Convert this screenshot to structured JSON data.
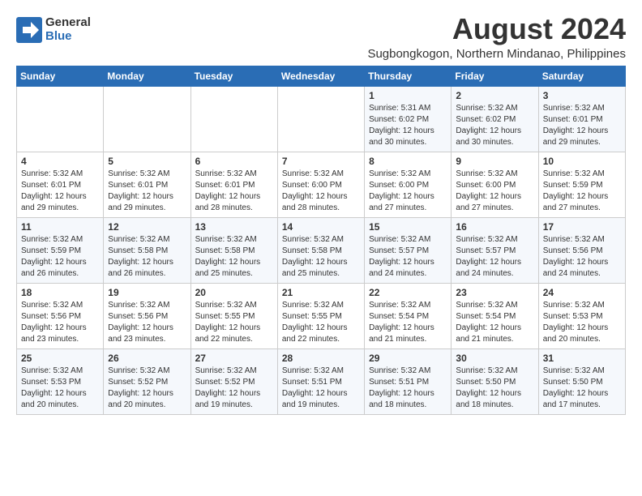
{
  "logo": {
    "general": "General",
    "blue": "Blue"
  },
  "title": {
    "month_year": "August 2024",
    "location": "Sugbongkogon, Northern Mindanao, Philippines"
  },
  "weekdays": [
    "Sunday",
    "Monday",
    "Tuesday",
    "Wednesday",
    "Thursday",
    "Friday",
    "Saturday"
  ],
  "weeks": [
    [
      {
        "day": "",
        "info": ""
      },
      {
        "day": "",
        "info": ""
      },
      {
        "day": "",
        "info": ""
      },
      {
        "day": "",
        "info": ""
      },
      {
        "day": "1",
        "info": "Sunrise: 5:31 AM\nSunset: 6:02 PM\nDaylight: 12 hours and 30 minutes."
      },
      {
        "day": "2",
        "info": "Sunrise: 5:32 AM\nSunset: 6:02 PM\nDaylight: 12 hours and 30 minutes."
      },
      {
        "day": "3",
        "info": "Sunrise: 5:32 AM\nSunset: 6:01 PM\nDaylight: 12 hours and 29 minutes."
      }
    ],
    [
      {
        "day": "4",
        "info": "Sunrise: 5:32 AM\nSunset: 6:01 PM\nDaylight: 12 hours and 29 minutes."
      },
      {
        "day": "5",
        "info": "Sunrise: 5:32 AM\nSunset: 6:01 PM\nDaylight: 12 hours and 29 minutes."
      },
      {
        "day": "6",
        "info": "Sunrise: 5:32 AM\nSunset: 6:01 PM\nDaylight: 12 hours and 28 minutes."
      },
      {
        "day": "7",
        "info": "Sunrise: 5:32 AM\nSunset: 6:00 PM\nDaylight: 12 hours and 28 minutes."
      },
      {
        "day": "8",
        "info": "Sunrise: 5:32 AM\nSunset: 6:00 PM\nDaylight: 12 hours and 27 minutes."
      },
      {
        "day": "9",
        "info": "Sunrise: 5:32 AM\nSunset: 6:00 PM\nDaylight: 12 hours and 27 minutes."
      },
      {
        "day": "10",
        "info": "Sunrise: 5:32 AM\nSunset: 5:59 PM\nDaylight: 12 hours and 27 minutes."
      }
    ],
    [
      {
        "day": "11",
        "info": "Sunrise: 5:32 AM\nSunset: 5:59 PM\nDaylight: 12 hours and 26 minutes."
      },
      {
        "day": "12",
        "info": "Sunrise: 5:32 AM\nSunset: 5:58 PM\nDaylight: 12 hours and 26 minutes."
      },
      {
        "day": "13",
        "info": "Sunrise: 5:32 AM\nSunset: 5:58 PM\nDaylight: 12 hours and 25 minutes."
      },
      {
        "day": "14",
        "info": "Sunrise: 5:32 AM\nSunset: 5:58 PM\nDaylight: 12 hours and 25 minutes."
      },
      {
        "day": "15",
        "info": "Sunrise: 5:32 AM\nSunset: 5:57 PM\nDaylight: 12 hours and 24 minutes."
      },
      {
        "day": "16",
        "info": "Sunrise: 5:32 AM\nSunset: 5:57 PM\nDaylight: 12 hours and 24 minutes."
      },
      {
        "day": "17",
        "info": "Sunrise: 5:32 AM\nSunset: 5:56 PM\nDaylight: 12 hours and 24 minutes."
      }
    ],
    [
      {
        "day": "18",
        "info": "Sunrise: 5:32 AM\nSunset: 5:56 PM\nDaylight: 12 hours and 23 minutes."
      },
      {
        "day": "19",
        "info": "Sunrise: 5:32 AM\nSunset: 5:56 PM\nDaylight: 12 hours and 23 minutes."
      },
      {
        "day": "20",
        "info": "Sunrise: 5:32 AM\nSunset: 5:55 PM\nDaylight: 12 hours and 22 minutes."
      },
      {
        "day": "21",
        "info": "Sunrise: 5:32 AM\nSunset: 5:55 PM\nDaylight: 12 hours and 22 minutes."
      },
      {
        "day": "22",
        "info": "Sunrise: 5:32 AM\nSunset: 5:54 PM\nDaylight: 12 hours and 21 minutes."
      },
      {
        "day": "23",
        "info": "Sunrise: 5:32 AM\nSunset: 5:54 PM\nDaylight: 12 hours and 21 minutes."
      },
      {
        "day": "24",
        "info": "Sunrise: 5:32 AM\nSunset: 5:53 PM\nDaylight: 12 hours and 20 minutes."
      }
    ],
    [
      {
        "day": "25",
        "info": "Sunrise: 5:32 AM\nSunset: 5:53 PM\nDaylight: 12 hours and 20 minutes."
      },
      {
        "day": "26",
        "info": "Sunrise: 5:32 AM\nSunset: 5:52 PM\nDaylight: 12 hours and 20 minutes."
      },
      {
        "day": "27",
        "info": "Sunrise: 5:32 AM\nSunset: 5:52 PM\nDaylight: 12 hours and 19 minutes."
      },
      {
        "day": "28",
        "info": "Sunrise: 5:32 AM\nSunset: 5:51 PM\nDaylight: 12 hours and 19 minutes."
      },
      {
        "day": "29",
        "info": "Sunrise: 5:32 AM\nSunset: 5:51 PM\nDaylight: 12 hours and 18 minutes."
      },
      {
        "day": "30",
        "info": "Sunrise: 5:32 AM\nSunset: 5:50 PM\nDaylight: 12 hours and 18 minutes."
      },
      {
        "day": "31",
        "info": "Sunrise: 5:32 AM\nSunset: 5:50 PM\nDaylight: 12 hours and 17 minutes."
      }
    ]
  ]
}
